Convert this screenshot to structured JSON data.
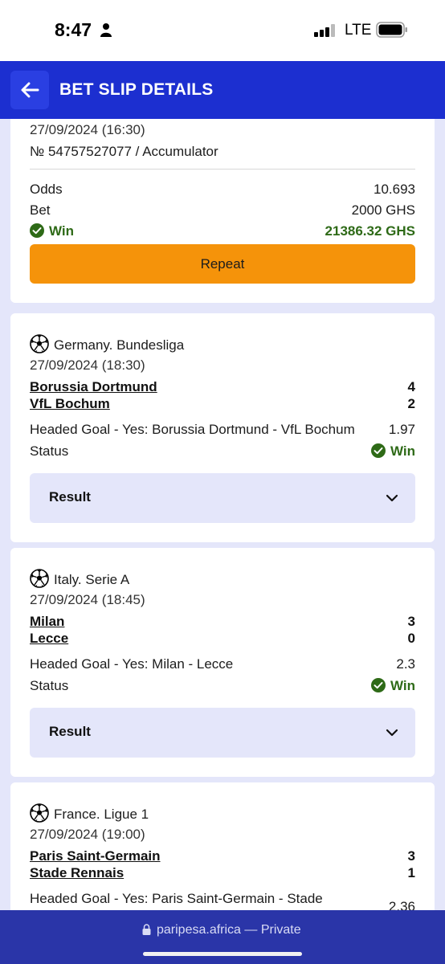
{
  "status_bar": {
    "time": "8:47",
    "network": "LTE"
  },
  "header": {
    "title": "BET SLIP DETAILS"
  },
  "summary": {
    "datetime": "27/09/2024 (16:30)",
    "ticket": "№ 54757527077 / Accumulator",
    "odds_label": "Odds",
    "odds_value": "10.693",
    "bet_label": "Bet",
    "bet_value": "2000 GHS",
    "win_label": "Win",
    "win_value": "21386.32 GHS",
    "repeat_label": "Repeat"
  },
  "events": [
    {
      "league": "Germany. Bundesliga",
      "datetime": "27/09/2024 (18:30)",
      "home_team": "Borussia Dortmund",
      "home_score": "4",
      "away_team": "VfL Bochum",
      "away_score": "2",
      "market": "Headed Goal - Yes: Borussia Dortmund - VfL Bochum",
      "odds": "1.97",
      "status_label": "Status",
      "status_value": "Win",
      "result_label": "Result"
    },
    {
      "league": "Italy. Serie A",
      "datetime": "27/09/2024 (18:45)",
      "home_team": "Milan",
      "home_score": "3",
      "away_team": "Lecce",
      "away_score": "0",
      "market": "Headed Goal - Yes: Milan - Lecce",
      "odds": "2.3",
      "status_label": "Status",
      "status_value": "Win",
      "result_label": "Result"
    },
    {
      "league": "France. Ligue 1",
      "datetime": "27/09/2024 (19:00)",
      "home_team": "Paris Saint-Germain",
      "home_score": "3",
      "away_team": "Stade Rennais",
      "away_score": "1",
      "market": "Headed Goal - Yes: Paris Saint-Germain - Stade",
      "odds": "2.36"
    }
  ],
  "browser": {
    "domain": "paripesa.africa",
    "mode": "— Private"
  },
  "colors": {
    "header": "#1c2fd0",
    "accent": "#f5930a",
    "win": "#2e6a17",
    "background": "#e4e6fa"
  }
}
